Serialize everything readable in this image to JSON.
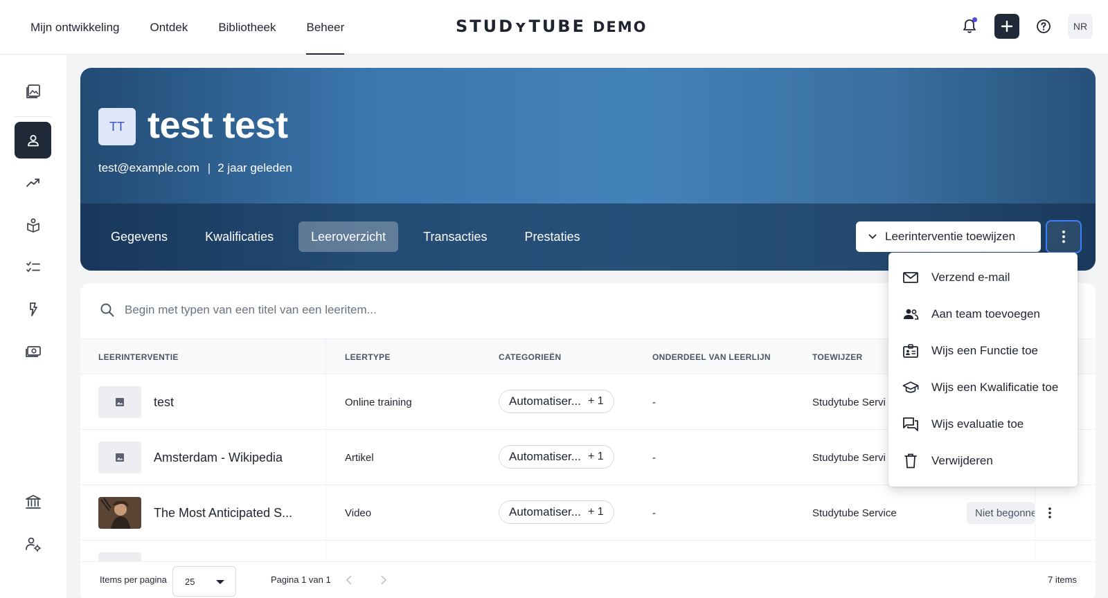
{
  "topnav": {
    "items": [
      {
        "label": "Mijn ontwikkeling"
      },
      {
        "label": "Ontdek"
      },
      {
        "label": "Bibliotheek"
      },
      {
        "label": "Beheer"
      }
    ],
    "active_index": 3
  },
  "brand": {
    "name": "STUDʏTUBE",
    "suffix": "DEMO"
  },
  "user": {
    "initials": "NR"
  },
  "profile": {
    "initials": "TT",
    "name": "test test",
    "email": "test@example.com",
    "separator": "|",
    "since": "2 jaar geleden"
  },
  "tabs": [
    {
      "label": "Gegevens"
    },
    {
      "label": "Kwalificaties"
    },
    {
      "label": "Leeroverzicht"
    },
    {
      "label": "Transacties"
    },
    {
      "label": "Prestaties"
    }
  ],
  "active_tab": "Leeroverzicht",
  "assign_button": {
    "label": "Leerinterventie toewijzen"
  },
  "search": {
    "placeholder": "Begin met typen van een titel van een leeritem..."
  },
  "table": {
    "headers": {
      "intervention": "LEERINTERVENTIE",
      "type": "LEERTYPE",
      "categories": "CATEGORIEËN",
      "part": "ONDERDEEL VAN LEERLIJN",
      "assigner": "TOEWIJZER"
    },
    "rows": [
      {
        "title": "test",
        "type": "Online training",
        "category": "Automatiser...",
        "extra": "+ 1",
        "part": "-",
        "assigner": "Studytube Servi"
      },
      {
        "title": "Amsterdam - Wikipedia",
        "type": "Artikel",
        "category": "Automatiser...",
        "extra": "+ 1",
        "part": "-",
        "assigner": "Studytube Servi"
      },
      {
        "title": "The Most Anticipated S...",
        "type": "Video",
        "category": "Automatiser...",
        "extra": "+ 1",
        "part": "-",
        "assigner": "Studytube Service",
        "status": "Niet begonnen"
      }
    ]
  },
  "pagination": {
    "items_per_page_label": "Items per pagina",
    "items_per_page": "25",
    "page_text": "Pagina 1 van 1",
    "total_items": "7 items"
  },
  "menu": {
    "items": [
      {
        "label": "Verzend e-mail",
        "icon": "mail-icon"
      },
      {
        "label": "Aan team toevoegen",
        "icon": "team-icon"
      },
      {
        "label": "Wijs een Functie toe",
        "icon": "id-card-icon"
      },
      {
        "label": "Wijs een Kwalificatie toe",
        "icon": "graduation-cap-icon"
      },
      {
        "label": "Wijs evaluatie toe",
        "icon": "chat-icon"
      },
      {
        "label": "Verwijderen",
        "icon": "trash-icon"
      }
    ]
  },
  "colors": {
    "primary_dark": "#1f2937",
    "hero_blue": "#3b76ad",
    "notification_dot": "#4f46e5",
    "focus_ring": "#3b82f6"
  }
}
